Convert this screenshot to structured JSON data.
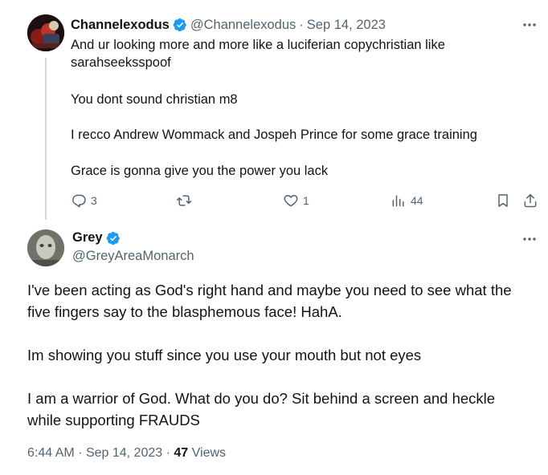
{
  "reply": {
    "author_name": "Channelexodus",
    "verified": true,
    "handle": "@Channelexodus",
    "separator": "·",
    "date": "Sep 14, 2023",
    "lines": [
      "And ur looking more and more like a luciferian copychristian like",
      "sarahseeksspoof",
      "You dont sound christian m8",
      "I recco Andrew Wommack and Jospeh Prince for some grace training",
      "Grace is gonna give you the power you lack"
    ],
    "actions": {
      "reply_icon": "reply-icon",
      "reply_count": "3",
      "retweet_icon": "retweet-icon",
      "retweet_count": "",
      "like_icon": "heart-icon",
      "like_count": "1",
      "views_icon": "analytics-icon",
      "views_count": "44",
      "bookmark_icon": "bookmark-icon",
      "share_icon": "share-icon"
    }
  },
  "main": {
    "author_name": "Grey",
    "verified": true,
    "handle": "@GreyAreaMonarch",
    "lines": [
      "I've been acting as God's right hand and maybe you need to see what the",
      "five fingers say to the blasphemous face! HahA.",
      "Im showing you stuff since you use your mouth but not eyes",
      "I am a warrior of God. What do you do? Sit behind a screen and heckle",
      "while supporting FRAUDS"
    ],
    "time": "6:44 AM",
    "separator": "·",
    "date": "Sep 14, 2023",
    "views_count": "47",
    "views_label": "Views"
  },
  "colors": {
    "accent": "#1d9bf0",
    "text": "#0f1419",
    "muted": "#536471",
    "thread_line": "#cfd9de"
  }
}
